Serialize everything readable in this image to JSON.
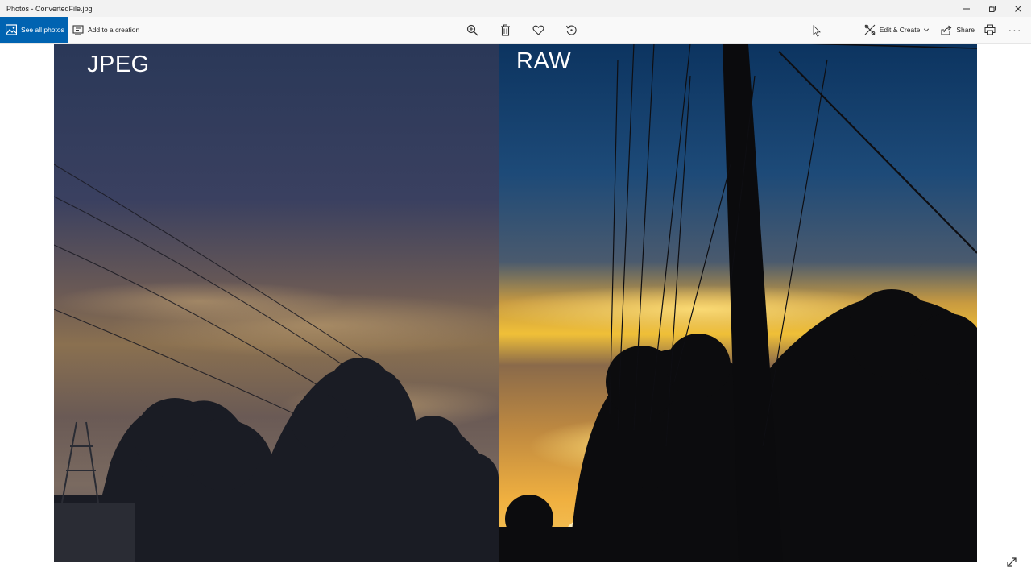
{
  "window": {
    "title": "Photos - ConvertedFile.jpg",
    "controls": [
      "minimize-icon",
      "restore-icon",
      "close-icon"
    ]
  },
  "toolbar": {
    "see_all_photos": "See all photos",
    "add_to_creation": "Add to a creation",
    "center_tools": [
      "zoom-in-icon",
      "delete-icon",
      "favorite-icon",
      "rotate-icon"
    ],
    "edit_create": "Edit & Create",
    "share": "Share",
    "more": "···"
  },
  "photo": {
    "left_label": "JPEG",
    "right_label": "RAW"
  },
  "colors": {
    "accent": "#0063b1",
    "titlebar": "#f2f2f2",
    "toolbar": "#f9f9f9"
  }
}
